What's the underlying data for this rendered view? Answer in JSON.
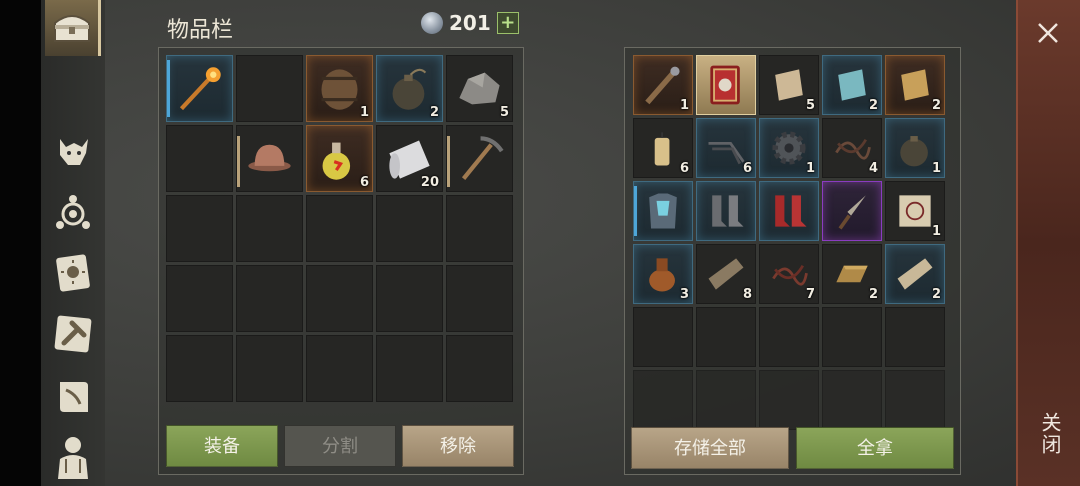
{
  "inventory": {
    "title": "物品栏",
    "currency": "201",
    "currency_add": "+",
    "slots": [
      {
        "icon": "fire-staff-icon",
        "count": "",
        "rarity": "blue"
      },
      {
        "icon": "",
        "count": ""
      },
      {
        "icon": "barrel-icon",
        "count": "1",
        "rarity": "orange"
      },
      {
        "icon": "bomb-icon",
        "count": "2",
        "rarity": "blue"
      },
      {
        "icon": "stone-icon",
        "count": "5"
      },
      {
        "icon": "",
        "count": ""
      },
      {
        "icon": "helmet-icon",
        "count": ""
      },
      {
        "icon": "potion-icon",
        "count": "6",
        "rarity": "orange"
      },
      {
        "icon": "cloth-roll-icon",
        "count": "20"
      },
      {
        "icon": "pickaxe-icon",
        "count": ""
      }
    ],
    "buttons": {
      "equip": "装备",
      "split": "分割",
      "remove": "移除"
    }
  },
  "container": {
    "slots": [
      {
        "icon": "spiked-club-icon",
        "count": "1",
        "rarity": "orange"
      },
      {
        "icon": "spellbook-icon",
        "count": "",
        "rarity": "gold"
      },
      {
        "icon": "paper-scrap-icon",
        "count": "5"
      },
      {
        "icon": "blueprint-scrap-icon",
        "count": "2",
        "rarity": "blue"
      },
      {
        "icon": "map-scrap-icon",
        "count": "2",
        "rarity": "orange"
      },
      {
        "icon": "candle-icon",
        "count": "6"
      },
      {
        "icon": "metal-rods-icon",
        "count": "6",
        "rarity": "blue"
      },
      {
        "icon": "gear-icon",
        "count": "1",
        "rarity": "blue"
      },
      {
        "icon": "scrap-wires-icon",
        "count": "4"
      },
      {
        "icon": "bomb-icon",
        "count": "1",
        "rarity": "blue"
      },
      {
        "icon": "armor-chest-icon",
        "count": "",
        "rarity": "blue"
      },
      {
        "icon": "boots-icon",
        "count": "",
        "rarity": "blue"
      },
      {
        "icon": "red-boots-icon",
        "count": "",
        "rarity": "blue"
      },
      {
        "icon": "dagger-icon",
        "count": "",
        "rarity": "purple"
      },
      {
        "icon": "scroll-rune-icon",
        "count": "1"
      },
      {
        "icon": "oil-jug-icon",
        "count": "3",
        "rarity": "blue"
      },
      {
        "icon": "wood-plank-icon",
        "count": "8"
      },
      {
        "icon": "scrap-wires-icon",
        "count": "7"
      },
      {
        "icon": "ingot-icon",
        "count": "2"
      },
      {
        "icon": "board-icon",
        "count": "2",
        "rarity": "blue"
      }
    ],
    "buttons": {
      "store_all": "存储全部",
      "take_all": "全拿"
    }
  },
  "close": {
    "label": "关闭"
  },
  "colors": {
    "accent_green": "#7c9a4c",
    "rarity_blue": "#4ea6d8",
    "rarity_orange": "#d8843c",
    "rarity_purple": "#a84ee0"
  }
}
